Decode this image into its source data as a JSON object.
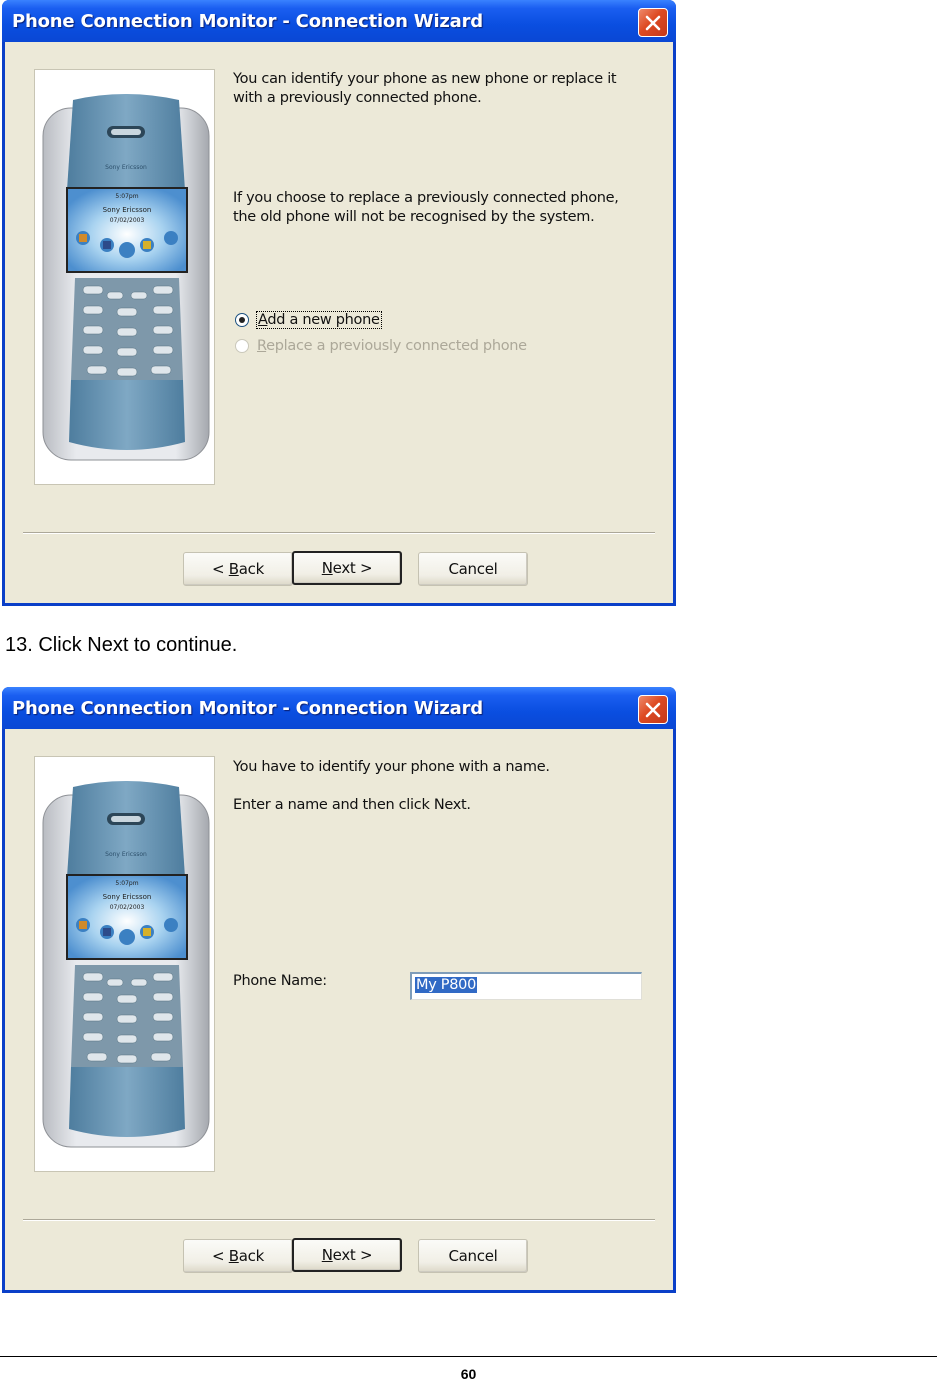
{
  "document": {
    "step_instruction": "13. Click Next to continue.",
    "page_number": "60"
  },
  "dialog1": {
    "title": "Phone Connection Monitor - Connection Wizard",
    "intro_text": "You can identify your phone as new phone or replace it with a previously connected phone.",
    "warning_text": "If you choose to replace a previously connected phone, the old phone will not be recognised by the system.",
    "options": [
      {
        "label_prefix": "",
        "mnemonic": "A",
        "label_rest": "dd a new phone",
        "selected": true,
        "enabled": true
      },
      {
        "label_prefix": "",
        "mnemonic": "R",
        "label_rest": "eplace a previously connected phone",
        "selected": false,
        "enabled": false
      }
    ],
    "buttons": {
      "back_prefix": "< ",
      "back_mnemonic": "B",
      "back_rest": "ack",
      "next_mnemonic": "N",
      "next_rest": "ext >",
      "cancel": "Cancel"
    },
    "phone_image": {
      "brand": "Sony Ericsson",
      "date": "07/02/2003",
      "time": "5:07pm"
    }
  },
  "dialog2": {
    "title": "Phone Connection Monitor - Connection Wizard",
    "intro_text": "You have to identify your phone with a name.",
    "instruction_text": "Enter a name and then click Next.",
    "field_label": "Phone Name:",
    "field_value": "My P800",
    "buttons": {
      "back_prefix": "< ",
      "back_mnemonic": "B",
      "back_rest": "ack",
      "next_mnemonic": "N",
      "next_rest": "ext >",
      "cancel": "Cancel"
    },
    "phone_image": {
      "brand": "Sony Ericsson",
      "date": "07/02/2003",
      "time": "5:07pm"
    }
  },
  "colors": {
    "titlebar_blue": "#0a4ee0",
    "dialog_face": "#ece9d8",
    "selection_blue": "#316ac5",
    "close_red": "#dd4a22"
  }
}
